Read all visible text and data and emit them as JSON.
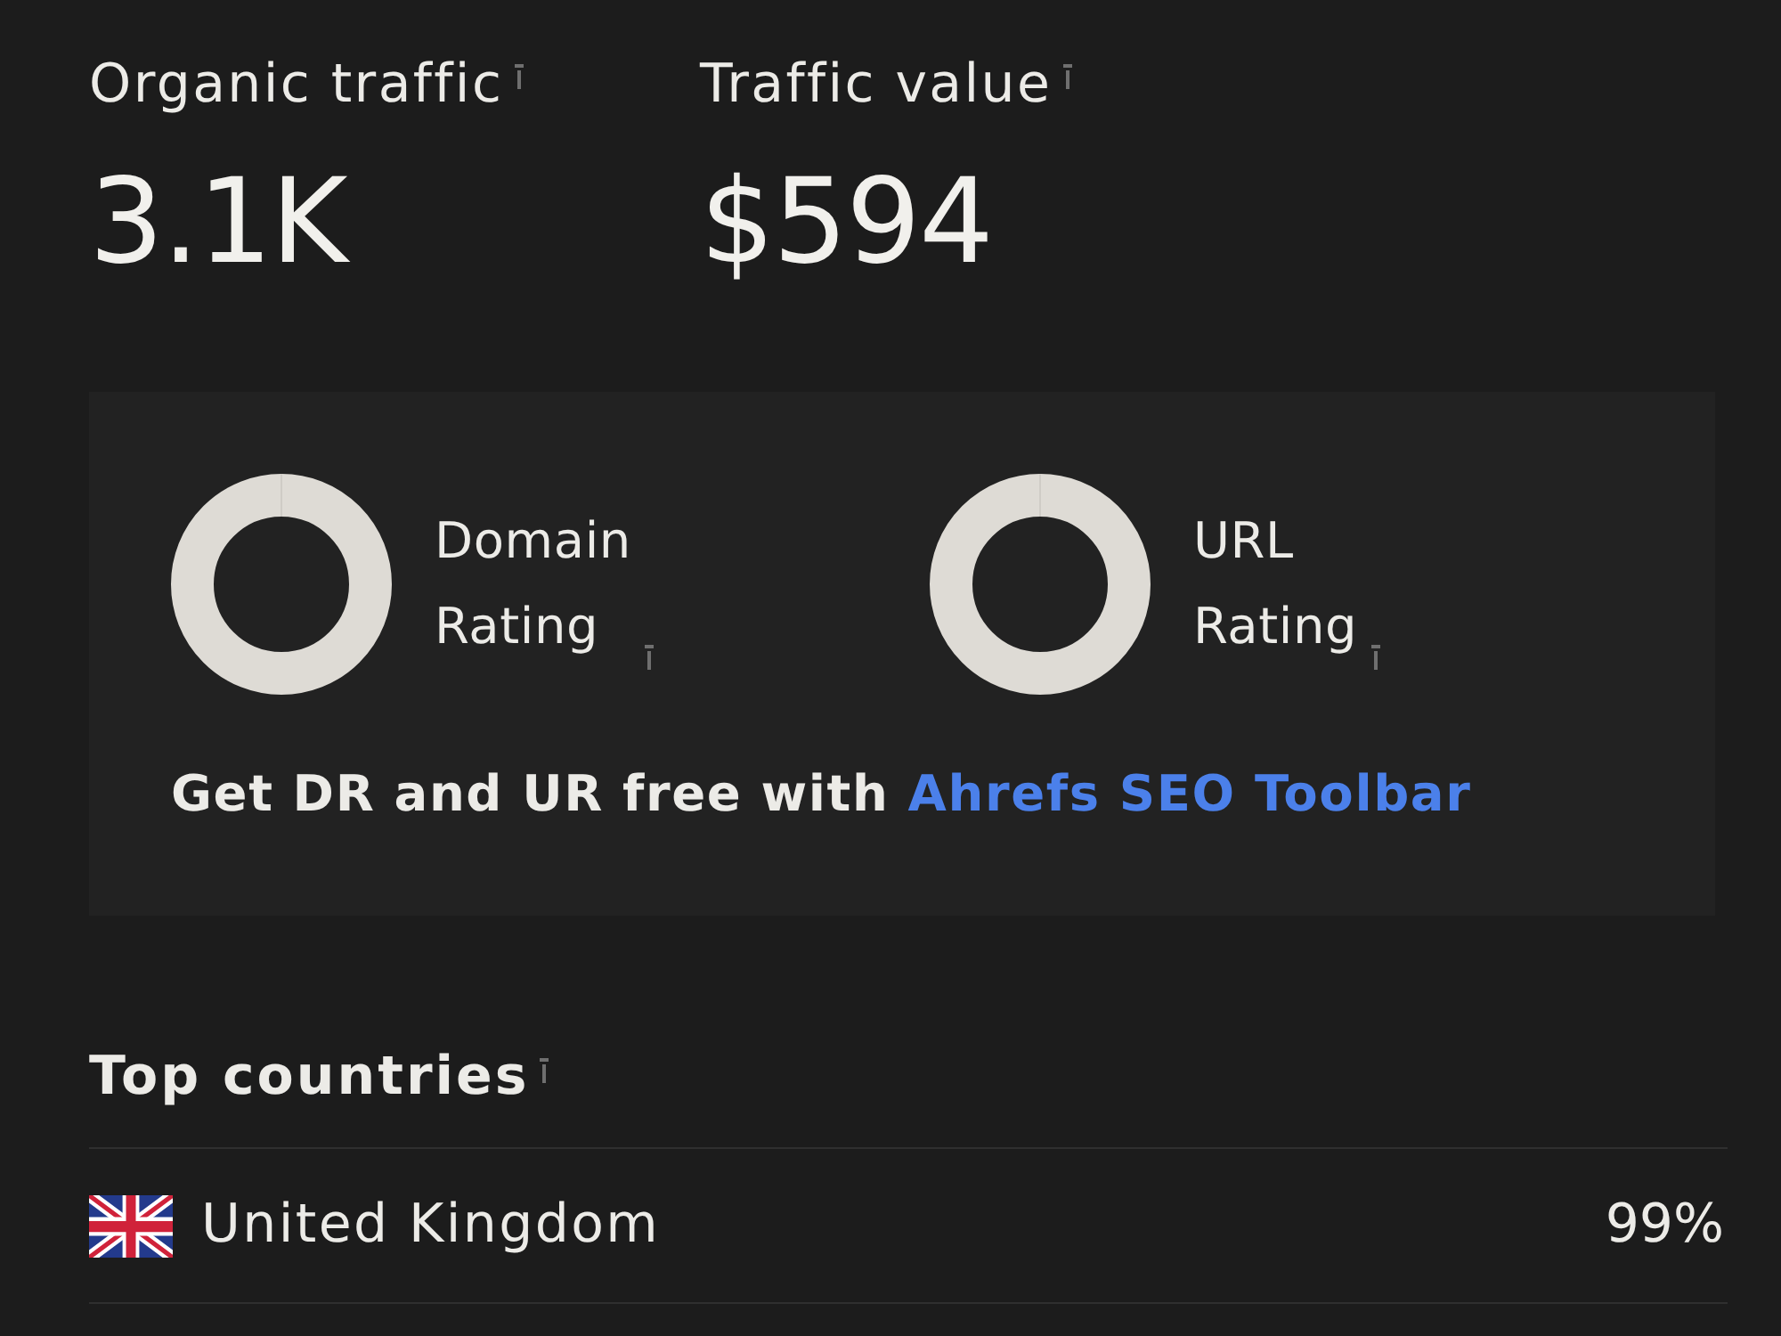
{
  "metrics": [
    {
      "label": "Organic traffic",
      "value": "3.1K"
    },
    {
      "label": "Traffic value",
      "value": "$594"
    }
  ],
  "rating_card": {
    "ratings": [
      {
        "label": "Domain Rating"
      },
      {
        "label": "URL Rating"
      }
    ],
    "promo": {
      "text": "Get DR and UR free with",
      "link": "Ahrefs SEO Toolbar"
    }
  },
  "top_countries": {
    "title": "Top countries",
    "rows": [
      {
        "country": "United Kingdom",
        "share": "99%"
      }
    ]
  }
}
